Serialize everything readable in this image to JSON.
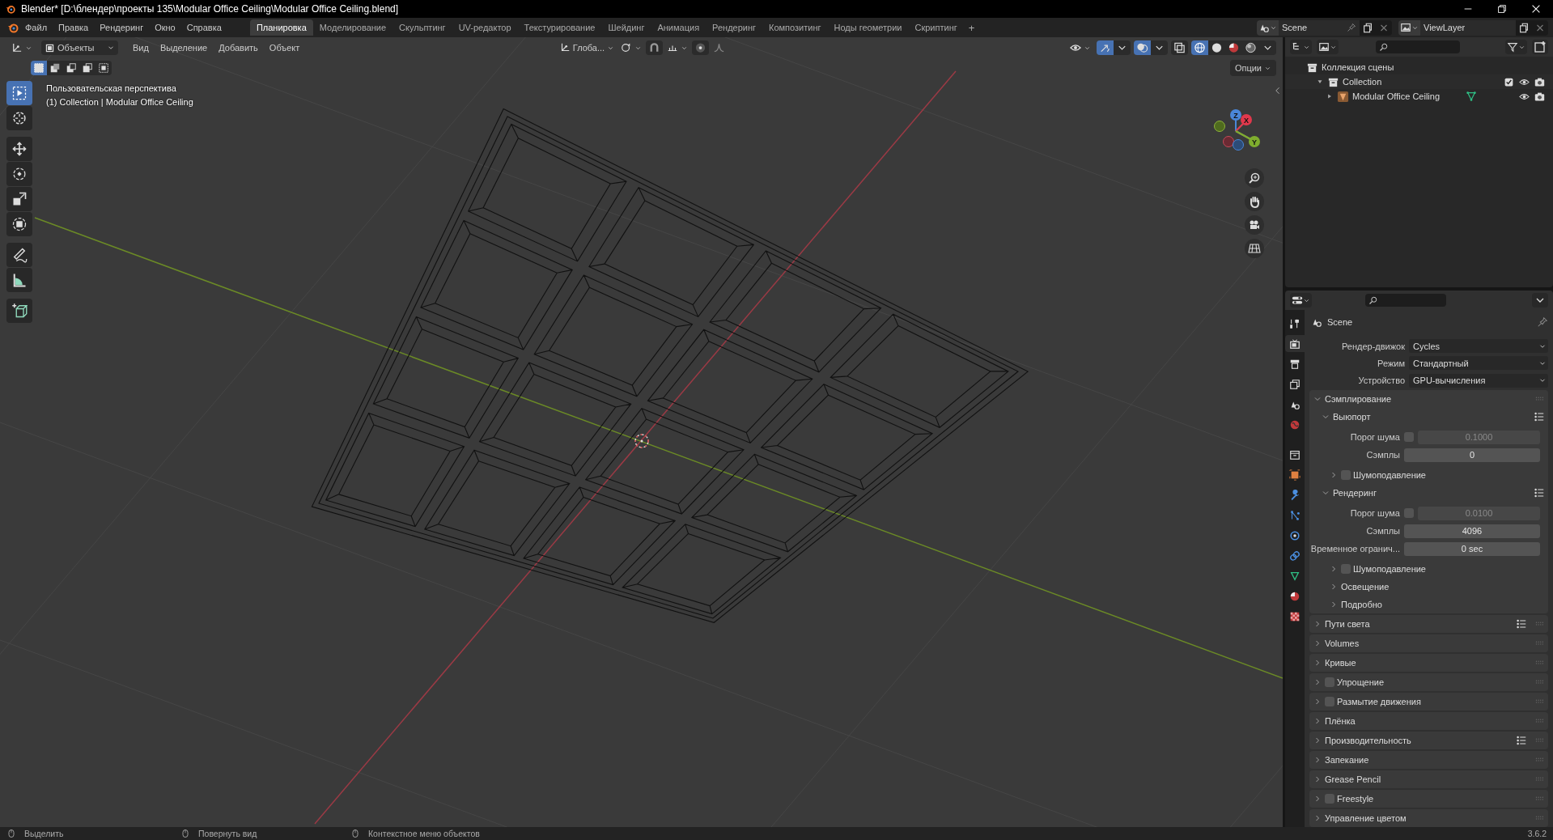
{
  "window": {
    "title": "Blender* [D:\\блендер\\проекты 135\\Modular Office Ceiling\\Modular Office Ceiling.blend]"
  },
  "menu": [
    "Файл",
    "Правка",
    "Рендеринг",
    "Окно",
    "Справка"
  ],
  "workspaces": [
    {
      "label": "Планировка",
      "selected": true
    },
    {
      "label": "Моделирование",
      "selected": false
    },
    {
      "label": "Скульптинг",
      "selected": false
    },
    {
      "label": "UV-редактор",
      "selected": false
    },
    {
      "label": "Текстурирование",
      "selected": false
    },
    {
      "label": "Шейдинг",
      "selected": false
    },
    {
      "label": "Анимация",
      "selected": false
    },
    {
      "label": "Рендеринг",
      "selected": false
    },
    {
      "label": "Композитинг",
      "selected": false
    },
    {
      "label": "Ноды геометрии",
      "selected": false
    },
    {
      "label": "Скриптинг",
      "selected": false
    }
  ],
  "add_workspace": "+",
  "scene": "Scene",
  "view_layer": "ViewLayer",
  "viewport": {
    "mode": "Объекты",
    "menus": [
      "Вид",
      "Выделение",
      "Добавить",
      "Объект"
    ],
    "orientation": "Глоба...",
    "options": "Опции",
    "select_modes": [
      {
        "selected": true
      },
      {
        "selected": false
      },
      {
        "selected": false
      },
      {
        "selected": false
      },
      {
        "selected": false
      }
    ],
    "shading": [
      {
        "kind": "wireframe",
        "selected": true
      },
      {
        "kind": "solid",
        "selected": false
      },
      {
        "kind": "material",
        "selected": false
      },
      {
        "kind": "rendered",
        "selected": false
      }
    ],
    "info": [
      "Пользовательская перспектива",
      "(1) Collection | Modular Office Ceiling"
    ],
    "tools": [
      {
        "kind": "select",
        "selected": true
      },
      {
        "kind": "cursor",
        "selected": false
      },
      {
        "kind": "move",
        "selected": false
      },
      {
        "kind": "rotate",
        "selected": false
      },
      {
        "kind": "scale",
        "selected": false
      },
      {
        "kind": "transform",
        "selected": false
      },
      {
        "kind": "annotate",
        "selected": false
      },
      {
        "kind": "measure",
        "selected": false
      },
      {
        "kind": "add-cube",
        "selected": false
      }
    ],
    "gizmo_labels": [
      "Z",
      "X",
      "Y"
    ]
  },
  "outliner": {
    "tree": [
      {
        "label": "Коллекция сцены",
        "kind": "scene-collection",
        "children": [
          {
            "label": "Collection",
            "kind": "collection",
            "expanded": true,
            "checked": true,
            "children": [
              {
                "label": "Modular Office Ceiling",
                "kind": "mesh-object",
                "expanded": false
              }
            ]
          }
        ]
      }
    ]
  },
  "properties": {
    "tabs": [
      {
        "kind": "tool",
        "selected": false
      },
      {
        "kind": "render",
        "selected": true
      },
      {
        "kind": "output",
        "selected": false
      },
      {
        "kind": "view-layer",
        "selected": false
      },
      {
        "kind": "scene",
        "selected": false
      },
      {
        "kind": "world",
        "selected": false
      },
      {
        "kind": "collection",
        "selected": false
      },
      {
        "kind": "object",
        "selected": false
      },
      {
        "kind": "modifiers",
        "selected": false
      },
      {
        "kind": "particles",
        "selected": false
      },
      {
        "kind": "physics",
        "selected": false
      },
      {
        "kind": "constraints",
        "selected": false
      },
      {
        "kind": "data",
        "selected": false
      },
      {
        "kind": "material",
        "selected": false
      },
      {
        "kind": "texture",
        "selected": false
      }
    ],
    "context": "Scene",
    "fields": [
      {
        "label": "Рендер-движок",
        "value": "Cycles"
      },
      {
        "label": "Режим",
        "value": "Стандартный"
      },
      {
        "label": "Устройство",
        "value": "GPU-вычисления"
      }
    ],
    "panels": [
      {
        "title": "Сэмплирование",
        "expanded": true,
        "children": [
          {
            "title": "Выюпорт",
            "expanded": true,
            "presets": true,
            "rows": [
              {
                "label": "Порог шума",
                "checked": false,
                "value": "0.1000"
              },
              {
                "label": "Сэмплы",
                "value": "0"
              }
            ],
            "children": [
              {
                "title": "Шумоподавление",
                "expanded": false,
                "checked": false
              }
            ]
          },
          {
            "title": "Рендеринг",
            "expanded": true,
            "presets": true,
            "rows": [
              {
                "label": "Порог шума",
                "checked": false,
                "value": "0.0100"
              },
              {
                "label": "Сэмплы",
                "value": "4096"
              },
              {
                "label": "Временное огранич...",
                "value": "0 sec"
              }
            ],
            "children": [
              {
                "title": "Шумоподавление",
                "expanded": false,
                "checked": false
              },
              {
                "title": "Освещение",
                "expanded": false
              },
              {
                "title": "Подробно",
                "expanded": false
              }
            ]
          }
        ]
      },
      {
        "title": "Пути света",
        "expanded": false,
        "presets": true
      },
      {
        "title": "Volumes",
        "expanded": false
      },
      {
        "title": "Кривые",
        "expanded": false
      },
      {
        "title": "Упрощение",
        "expanded": false,
        "checked": false
      },
      {
        "title": "Размытие движения",
        "expanded": false,
        "checked": false
      },
      {
        "title": "Плёнка",
        "expanded": false
      },
      {
        "title": "Производительность",
        "expanded": false,
        "presets": true
      },
      {
        "title": "Запекание",
        "expanded": false
      },
      {
        "title": "Grease Pencil",
        "expanded": false
      },
      {
        "title": "Freestyle",
        "expanded": false,
        "checked": false
      },
      {
        "title": "Управление цветом",
        "expanded": false
      }
    ]
  },
  "status_bar": {
    "items": [
      "Выделить",
      "Повернуть вид",
      "Контекстное меню объектов"
    ],
    "version": "3.6.2"
  }
}
